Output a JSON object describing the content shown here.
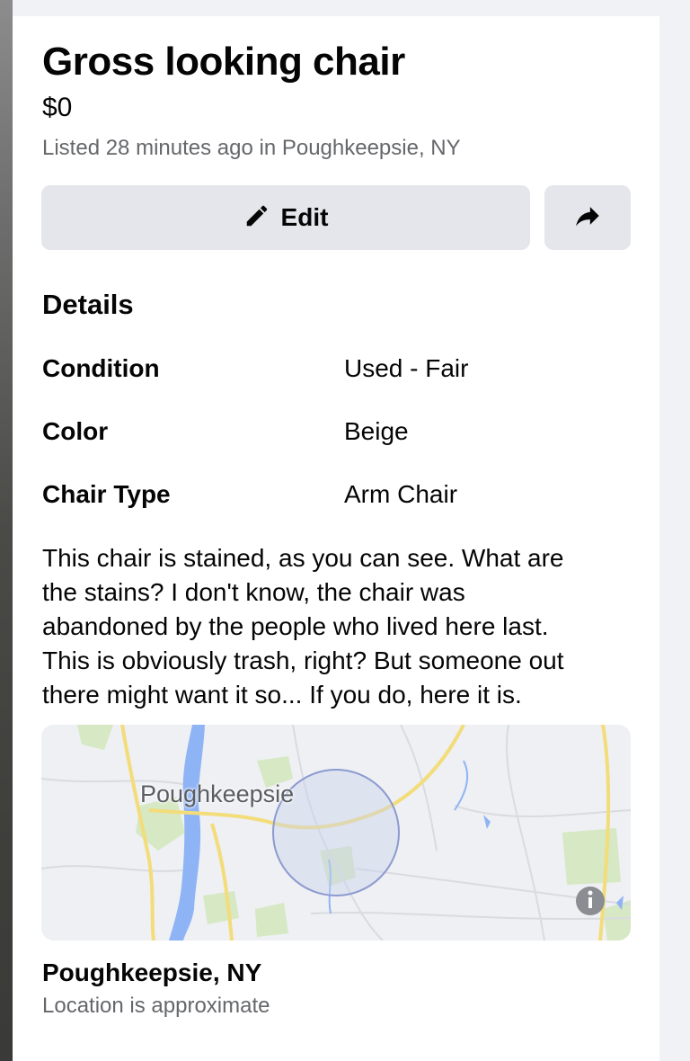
{
  "listing": {
    "title": "Gross looking chair",
    "price": "$0",
    "listed_info": "Listed 28 minutes ago in Poughkeepsie, NY"
  },
  "actions": {
    "edit_label": "Edit",
    "edit_icon": "pencil-icon",
    "share_icon": "share-arrow-icon"
  },
  "details": {
    "heading": "Details",
    "rows": [
      {
        "label": "Condition",
        "value": "Used - Fair"
      },
      {
        "label": "Color",
        "value": "Beige"
      },
      {
        "label": "Chair Type",
        "value": "Arm Chair"
      }
    ]
  },
  "description": "This chair is stained, as you can see. What are\nthe stains? I don't know, the chair was\nabandoned by the people who lived here last.\nThis is obviously trash, right? But someone out\nthere might want it so... If you do, here it is.",
  "map": {
    "city_label": "Poughkeepsie",
    "info_icon": "info-icon"
  },
  "location": {
    "name": "Poughkeepsie, NY",
    "note": "Location is approximate"
  },
  "colors": {
    "button_bg": "#e4e6eb",
    "secondary_text": "#65676b",
    "river": "#8fb4f5",
    "road": "#f3dc7a",
    "park": "#d6e8c4",
    "radius_circle": "#c9d2ee"
  }
}
